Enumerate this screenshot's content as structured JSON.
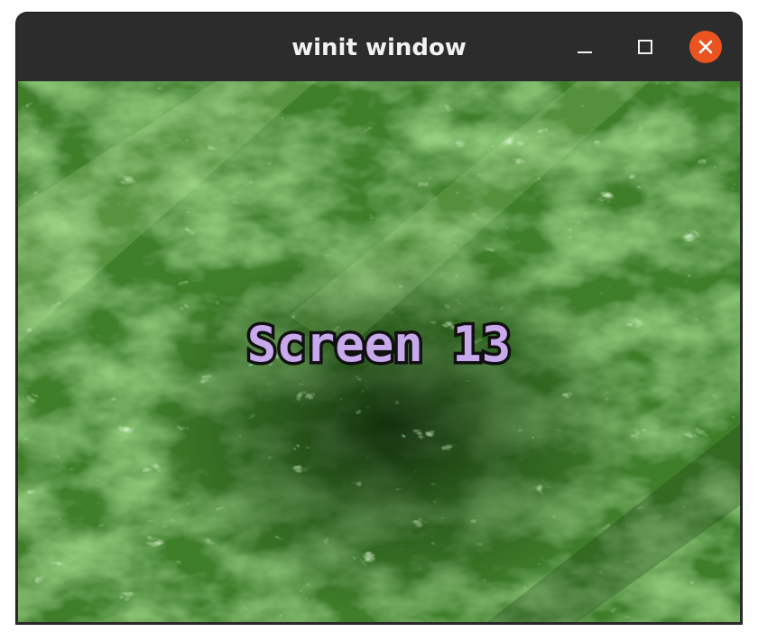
{
  "window": {
    "title": "winit window",
    "controls": {
      "minimize_icon": "minimize-icon",
      "maximize_icon": "maximize-icon",
      "close_icon": "close-icon"
    },
    "colors": {
      "titlebar": "#2c2c2c",
      "title_text": "#f2f2f2",
      "close_button": "#e95420"
    }
  },
  "canvas": {
    "label": "Screen 13",
    "label_color": "#c7a9ec",
    "outline_color": "#111111",
    "background_colors": [
      "#4f8f32",
      "#7fbf57",
      "#b6e890",
      "#1f4a14",
      "#5ee39a"
    ]
  }
}
